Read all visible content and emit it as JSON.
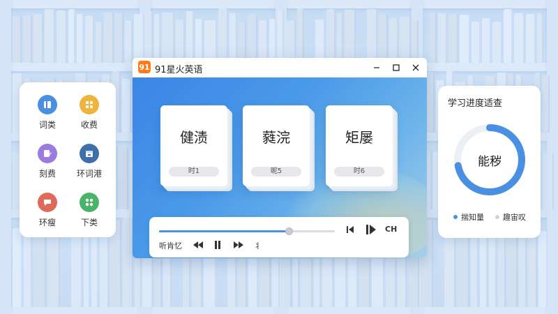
{
  "window": {
    "logo": "91",
    "title": "91星火英语",
    "minimize": "—",
    "maximize": "☐",
    "close": "✕"
  },
  "sidebar": {
    "items": [
      {
        "label": "词类",
        "icon": "book-icon",
        "color": "#4a8fe0"
      },
      {
        "label": "收费",
        "icon": "grid-icon",
        "color": "#f0b43c"
      },
      {
        "label": "刻费",
        "icon": "edit-icon",
        "color": "#9b7be0"
      },
      {
        "label": "环词港",
        "icon": "calendar-icon",
        "color": "#3e6fa8"
      },
      {
        "label": "环瘦",
        "icon": "chat-icon",
        "color": "#e06a5a"
      },
      {
        "label": "下类",
        "icon": "apps-icon",
        "color": "#4cb36a"
      }
    ]
  },
  "cards": [
    {
      "word": "健渍",
      "tag": "时1"
    },
    {
      "word": "蕤浣",
      "tag": "昵5"
    },
    {
      "word": "矩屡",
      "tag": "时6"
    }
  ],
  "player": {
    "progress": 0.74,
    "left_label": "听肯忆",
    "rewind_icon": "rewind-icon",
    "pause_icon": "pause-icon",
    "forward_icon": "fast-forward-icon",
    "speed_label": "丬",
    "prev_icon": "skip-previous-icon",
    "play_icon": "play-icon",
    "lang_label": "CH"
  },
  "progress_panel": {
    "title": "学习进度适查",
    "center": "能秽",
    "ratio": 0.72,
    "accent": "#4a90e2",
    "legend": [
      {
        "label": "揣知量",
        "color": "#4a90e2"
      },
      {
        "label": "趣宙叹",
        "color": "#cfd4da"
      }
    ]
  }
}
